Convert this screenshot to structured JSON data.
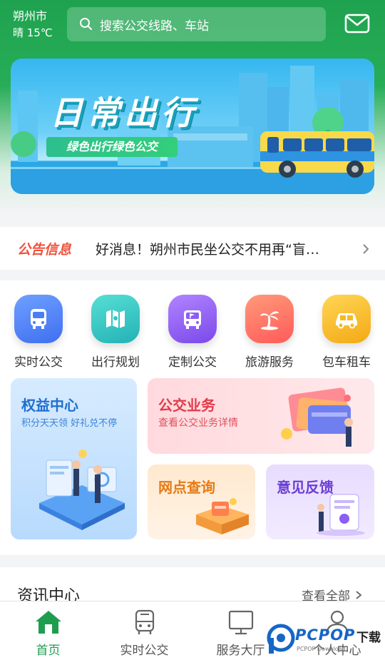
{
  "header": {
    "city": "朔州市",
    "weather": "晴 15℃",
    "search_placeholder": "搜索公交线路、车站"
  },
  "banner": {
    "title": "日常出行",
    "slogan": "绿色出行绿色公交"
  },
  "notice": {
    "tag": "公告信息",
    "message": "好消息！朔州市民坐公交不用再“盲…"
  },
  "services": [
    {
      "label": "实时公交",
      "icon": "bus-icon",
      "color": "#4a7ef6"
    },
    {
      "label": "出行规划",
      "icon": "map-icon",
      "color": "#2fc6c2"
    },
    {
      "label": "定制公交",
      "icon": "bus-flag-icon",
      "color": "#8b5cf6"
    },
    {
      "label": "旅游服务",
      "icon": "palm-tree-icon",
      "color": "#ff6f61"
    },
    {
      "label": "包车租车",
      "icon": "car-icon",
      "color": "#f6b91f"
    }
  ],
  "cards": {
    "rights": {
      "title": "权益中心",
      "subtitle": "积分天天领 好礼兑不停"
    },
    "bus_business": {
      "title": "公交业务",
      "subtitle": "查看公交业务详情"
    },
    "outlet": {
      "title": "网点查询"
    },
    "feedback": {
      "title": "意见反馈"
    }
  },
  "news": {
    "title": "资讯中心",
    "more": "查看全部"
  },
  "tabs": [
    {
      "label": "首页",
      "icon": "home-icon",
      "active": true
    },
    {
      "label": "实时公交",
      "icon": "bus-icon",
      "active": false
    },
    {
      "label": "服务大厅",
      "icon": "monitor-icon",
      "active": false
    },
    {
      "label": "个人中心",
      "icon": "user-icon",
      "active": false
    }
  ],
  "watermark": {
    "brand": "PCPOP",
    "download": "下载",
    "url": "PCPOP Download"
  },
  "colors": {
    "primary": "#1fa24f",
    "notice_tag": "#f0523d"
  }
}
